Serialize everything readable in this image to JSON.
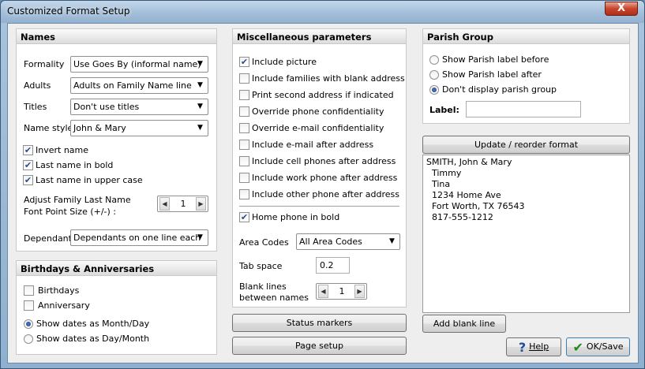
{
  "window": {
    "title": "Customized Format Setup",
    "close_label": "X"
  },
  "names": {
    "header": "Names",
    "formality": {
      "label": "Formality",
      "value": "Use Goes By (informal name)"
    },
    "adults": {
      "label": "Adults",
      "value": "Adults on Family Name line"
    },
    "titles": {
      "label": "Titles",
      "value": "Don't use titles"
    },
    "name_style": {
      "label": "Name style",
      "value": "John & Mary"
    },
    "invert_name": {
      "label": "Invert name",
      "checked": true
    },
    "last_bold": {
      "label": "Last name in bold",
      "checked": true
    },
    "last_upper": {
      "label": "Last name in upper case",
      "checked": true
    },
    "adjust_label_1": "Adjust Family Last Name",
    "adjust_label_2": "Font Point Size (+/-) :",
    "adjust_value": "1",
    "dependants": {
      "label": "Dependants",
      "value": "Dependants on one line each"
    }
  },
  "birthdays": {
    "header": "Birthdays & Anniversaries",
    "birthdays": {
      "label": "Birthdays",
      "checked": false
    },
    "anniversary": {
      "label": "Anniversary",
      "checked": false
    },
    "month_day": {
      "label": "Show dates as Month/Day",
      "selected": true
    },
    "day_month": {
      "label": "Show dates as Day/Month",
      "selected": false
    }
  },
  "misc": {
    "header": "Miscellaneous parameters",
    "options": [
      {
        "label": "Include picture",
        "checked": true
      },
      {
        "label": "Include families with blank address",
        "checked": false
      },
      {
        "label": "Print second address if indicated",
        "checked": false
      },
      {
        "label": "Override phone confidentiality",
        "checked": false
      },
      {
        "label": "Override e-mail confidentiality",
        "checked": false
      },
      {
        "label": "Include e-mail after address",
        "checked": false
      },
      {
        "label": "Include cell phones after address",
        "checked": false
      },
      {
        "label": "Include work phone after address",
        "checked": false
      },
      {
        "label": "Include other phone after address",
        "checked": false
      }
    ],
    "home_phone_bold": {
      "label": "Home phone in bold",
      "checked": true
    },
    "area_codes": {
      "label": "Area Codes",
      "value": "All Area Codes"
    },
    "tab_space": {
      "label": "Tab space",
      "value": "0.2"
    },
    "blank_lines_1": "Blank lines",
    "blank_lines_2": "between names",
    "blank_lines_value": "1",
    "status_markers": "Status markers",
    "page_setup": "Page setup"
  },
  "parish": {
    "header": "Parish Group",
    "before": {
      "label": "Show Parish label before",
      "selected": false
    },
    "after": {
      "label": "Show Parish label after",
      "selected": false
    },
    "none": {
      "label": "Don't display parish group",
      "selected": true
    },
    "label_label": "Label:",
    "label_value": ""
  },
  "format": {
    "update_button": "Update / reorder format",
    "preview_lines": [
      "SMITH, John & Mary",
      "  Timmy",
      "  Tina",
      "  1234 Home Ave",
      "  Fort Worth, TX 76543",
      "  817-555-1212"
    ],
    "add_blank_line": "Add blank line"
  },
  "footer": {
    "help": "Help",
    "ok_save": "OK/Save"
  },
  "icons": {
    "check": "✔",
    "arrow_down": "▼",
    "arrow_left": "◀",
    "arrow_right": "▶"
  }
}
